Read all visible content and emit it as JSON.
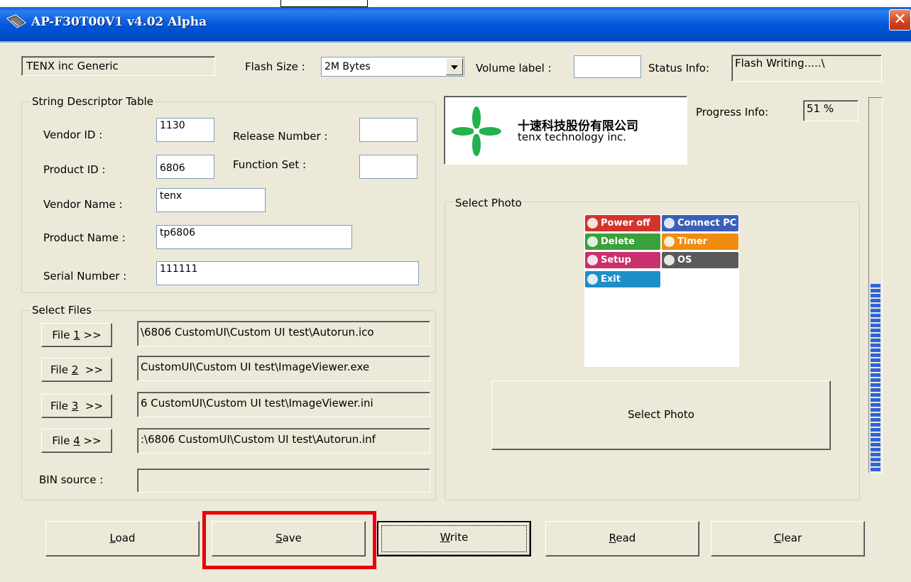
{
  "window": {
    "title": "AP-F30T00V1 v4.02 Alpha",
    "close_glyph": "✕"
  },
  "header": {
    "company": "TENX inc Generic",
    "flash_size_label": "Flash Size :",
    "flash_size_value": "2M Bytes",
    "volume_label_label": "Volume label :",
    "volume_label_value": "",
    "status_info_label": "Status Info:",
    "status_info_value": "Flash Writing.....\\"
  },
  "string_descriptor": {
    "title": "String Descriptor Table",
    "vendor_id_label": "Vendor ID :",
    "vendor_id": "1130",
    "release_number_label": "Release Number :",
    "release_number": "",
    "product_id_label": "Product ID :",
    "product_id": "6806",
    "function_set_label": "Function Set :",
    "function_set": "",
    "vendor_name_label": "Vendor Name :",
    "vendor_name": "tenx",
    "product_name_label": "Product Name :",
    "product_name": "tp6806",
    "serial_number_label": "Serial Number :",
    "serial_number": "111111"
  },
  "select_files": {
    "title": "Select Files",
    "files": [
      {
        "label_prefix": "File ",
        "label_key": "1",
        "label_suffix": " >>",
        "path": "\\6806 CustomUI\\Custom UI test\\Autorun.ico"
      },
      {
        "label_prefix": "File ",
        "label_key": "2",
        "label_suffix": "  >>",
        "path": "CustomUI\\Custom UI test\\ImageViewer.exe"
      },
      {
        "label_prefix": "File ",
        "label_key": "3",
        "label_suffix": "  >>",
        "path": "6 CustomUI\\Custom UI test\\ImageViewer.ini"
      },
      {
        "label_prefix": "File ",
        "label_key": "4",
        "label_suffix": " >>",
        "path": ":\\6806 CustomUI\\Custom UI test\\Autorun.inf"
      }
    ],
    "bin_source_label": "BIN source :",
    "bin_source_value": ""
  },
  "logo": {
    "chinese_name": "十速科技股份有限公司",
    "english_name": "tenx technology inc.",
    "brand_color": "#22b14c"
  },
  "progress": {
    "label": "Progress Info:",
    "value_text": "51 %",
    "fraction": 0.51,
    "bar_color": "#2f63d6"
  },
  "select_photo": {
    "title": "Select Photo",
    "button_label": "Select Photo",
    "menu_items": [
      {
        "label": "Power off",
        "color": "#d2342b"
      },
      {
        "label": "Connect PC",
        "color": "#3b5fb8"
      },
      {
        "label": "Delete",
        "color": "#3aa03a"
      },
      {
        "label": "Timer",
        "color": "#f08c10"
      },
      {
        "label": "Setup",
        "color": "#c8306e"
      },
      {
        "label": "OS",
        "color": "#5a5a5a"
      },
      {
        "label": "Exit",
        "color": "#1d8fc7"
      }
    ]
  },
  "buttons": {
    "load": {
      "key": "L",
      "rest": "oad"
    },
    "save": {
      "key": "S",
      "rest": "ave"
    },
    "write": {
      "key": "W",
      "rest": "rite"
    },
    "read": {
      "key": "R",
      "rest": "ead"
    },
    "clear": {
      "key": "C",
      "rest": "lear"
    }
  },
  "highlight_color": "#e8000b"
}
